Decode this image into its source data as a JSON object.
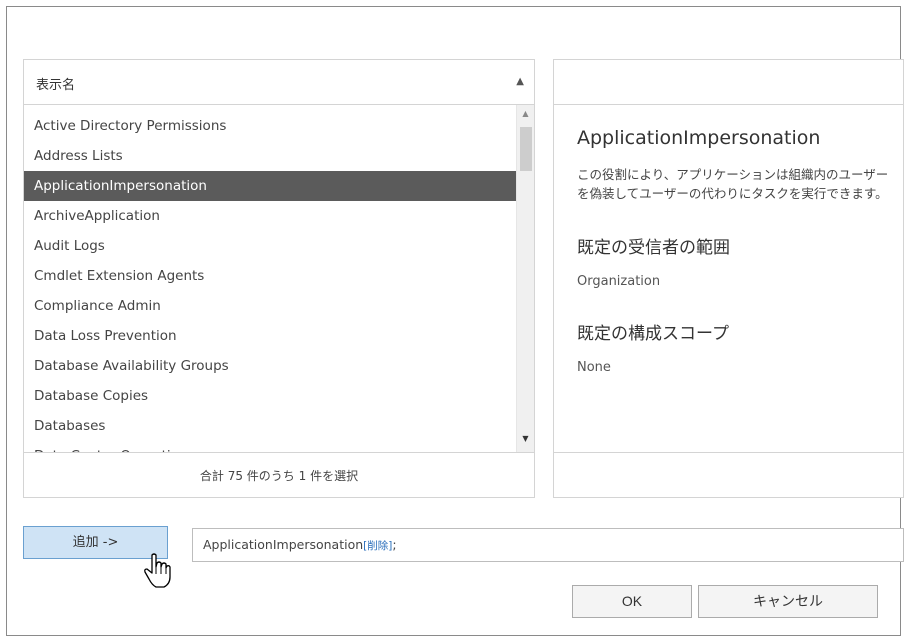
{
  "list": {
    "header": "表示名",
    "items": [
      "Active Directory Permissions",
      "Address Lists",
      "ApplicationImpersonation",
      "ArchiveApplication",
      "Audit Logs",
      "Cmdlet Extension Agents",
      "Compliance Admin",
      "Data Loss Prevention",
      "Database Availability Groups",
      "Database Copies",
      "Databases",
      "Data Center Operations"
    ],
    "selected_index": 2,
    "footer": "合計 75 件のうち 1 件を選択"
  },
  "detail": {
    "title": "ApplicationImpersonation",
    "description": "この役割により、アプリケーションは組織内のユーザーを偽装してユーザーの代わりにタスクを実行できます。",
    "recipient_scope_label": "既定の受信者の範囲",
    "recipient_scope_value": "Organization",
    "config_scope_label": "既定の構成スコープ",
    "config_scope_value": "None"
  },
  "add_button_label": "追加 ->",
  "selected": {
    "value": "ApplicationImpersonation",
    "remove_label": "[削除]",
    "separator": ";"
  },
  "ok_label": "OK",
  "cancel_label": "キャンセル",
  "colors": {
    "selected_row": "#5b5b5b",
    "add_button_bg": "#cfe3f5",
    "link": "#2a6ebb"
  }
}
